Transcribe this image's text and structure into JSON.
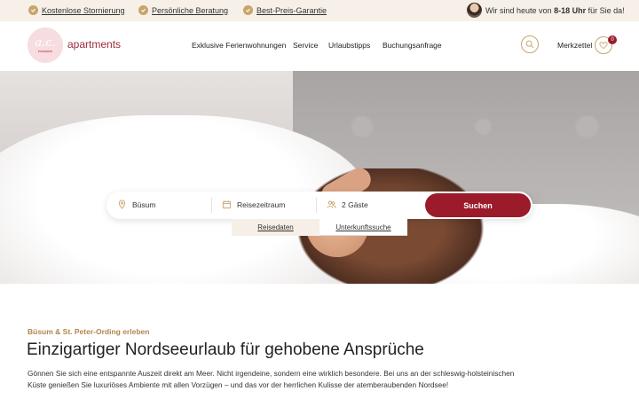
{
  "topbar": {
    "usp": [
      "Kostenlose Stornierung",
      "Persönliche Beratung",
      "Best-Preis-Garantie"
    ],
    "contact_prefix": "Wir sind heute von ",
    "contact_hours": "8-18 Uhr",
    "contact_suffix": " für Sie da!"
  },
  "header": {
    "logo_text": "a.c.",
    "logo_sub": "exclusive",
    "brand": "apartments",
    "nav": [
      "Exklusive Ferienwohnungen",
      "Service",
      "Urlaubstipps",
      "Buchungsanfrage"
    ],
    "merkzettel_label": "Merkzettel",
    "merkzettel_count": "0"
  },
  "search": {
    "location": "Büsum",
    "period": "Reisezeitraum",
    "guests": "2 Gäste",
    "submit": "Suchen",
    "tabs": [
      "Reisedaten",
      "Unterkunftssuche"
    ]
  },
  "content": {
    "kicker": "Büsum & St. Peter-Ording erleben",
    "headline": "Einzigartiger Nordseeurlaub für gehobene Ansprüche",
    "intro": "Gönnen Sie sich eine entspannte Auszeit direkt am Meer. Nicht irgendeine, sondern eine wirklich besondere. Bei uns an der schleswig-holsteinischen Küste genießen Sie luxuriöses Ambiente mit allen Vorzügen – und das vor der herrlichen Kulisse der atemberaubenden Nordsee!"
  },
  "colors": {
    "accent_gold": "#c8a56a",
    "brand_red": "#9b1b2a",
    "topbar_bg": "#f6f0e8"
  }
}
